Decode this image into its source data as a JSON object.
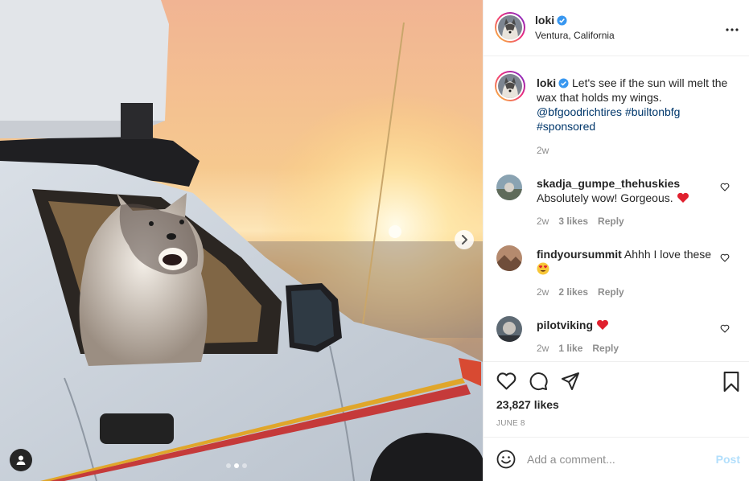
{
  "post": {
    "author": "loki",
    "location": "Ventura, California",
    "caption": "Let's see if the sun will melt the wax that holds my wings.",
    "caption_mentions": [
      "@bfgoodrichtires",
      "#builtonbfg",
      "#sponsored"
    ],
    "caption_time": "2w",
    "likes": "23,827 likes",
    "date": "JUNE 8",
    "carousel": {
      "count": 3,
      "active": 1
    }
  },
  "comments": [
    {
      "user": "skadja_gumpe_thehuskies",
      "text": "Absolutely wow! Gorgeous.",
      "emoji": "red-heart",
      "time": "2w",
      "likes": "3 likes",
      "reply": "Reply"
    },
    {
      "user": "findyoursummit",
      "text": "Ahhh I love these",
      "emoji": "heart-eyes",
      "time": "2w",
      "likes": "2 likes",
      "reply": "Reply"
    },
    {
      "user": "pilotviking",
      "text": "",
      "emoji": "red-heart",
      "time": "2w",
      "likes": "1 like",
      "reply": "Reply"
    }
  ],
  "add_comment": {
    "placeholder": "Add a comment...",
    "post_label": "Post"
  },
  "icons": {
    "verified": "verified-badge-icon",
    "more": "more-options-icon",
    "like": "heart-outline-icon",
    "comment": "comment-bubble-icon",
    "share": "paper-plane-icon",
    "save": "bookmark-icon",
    "emoji": "smiley-icon",
    "next": "chevron-right-icon",
    "tags": "user-tag-icon"
  },
  "colors": {
    "link": "#00376b",
    "verified": "#3897f0",
    "heart": "#ed4956",
    "post_disabled": "#b2dffc",
    "muted": "#8e8e8e"
  }
}
